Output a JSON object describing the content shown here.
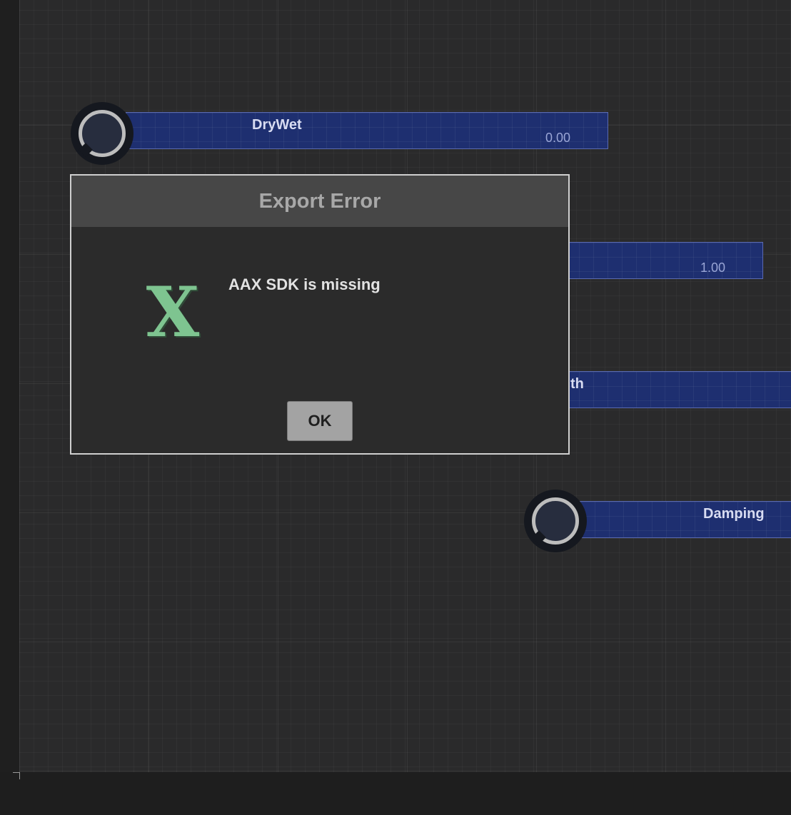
{
  "controls": {
    "drywet": {
      "label": "DryWet",
      "value": "0.00"
    },
    "second": {
      "value": "1.00"
    },
    "third": {
      "label_fragment": "th"
    },
    "damping": {
      "label": "Damping"
    }
  },
  "dialog": {
    "title": "Export Error",
    "icon_glyph": "X",
    "message": "AAX SDK is missing",
    "ok_label": "OK"
  },
  "colors": {
    "canvas": "#2a2a2b",
    "slider_fill": "#1e2f70",
    "dialog_header": "#474747",
    "icon": "#7ec490"
  }
}
